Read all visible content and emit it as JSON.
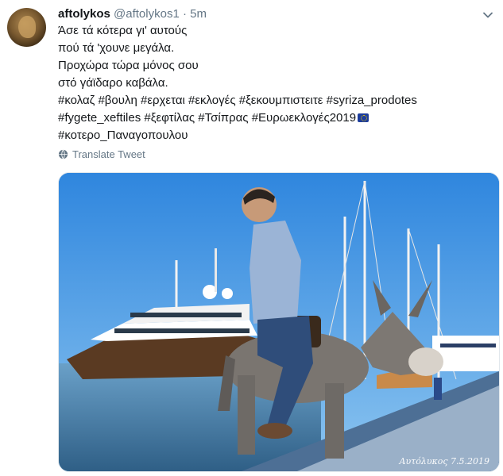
{
  "tweet": {
    "name": "aftolykos",
    "handle": "@aftolykos1",
    "separator": "·",
    "time": "5m",
    "lines": [
      "Άσε τά κότερα γι' αυτούς",
      "πού τά 'χουνε μεγάλα.",
      "Προχώρα τώρα μόνος σου",
      "στό γάϊδαρο καβάλα."
    ],
    "hashtags": [
      "#κολαζ",
      "#βουλη",
      "#ερχεται",
      "#εκλογές",
      "#ξεκουμπιστειτε",
      "#syriza_prodotes",
      "#fygete_xeftiles",
      "#ξεφτίλας",
      "#Τσίπρας",
      "#Ευρωεκλογές2019",
      "#κοτερο_Παναγοπουλου"
    ],
    "translate_label": "Translate Tweet",
    "media_watermark": "Αυτόλυκος  7.5.2019"
  },
  "icons": {
    "caret": "chevron-down-icon",
    "translate": "globe-icon",
    "flag": "eu-flag-emoji"
  },
  "colors": {
    "link": "#1b95e0",
    "muted": "#657786",
    "text": "#14171a"
  }
}
